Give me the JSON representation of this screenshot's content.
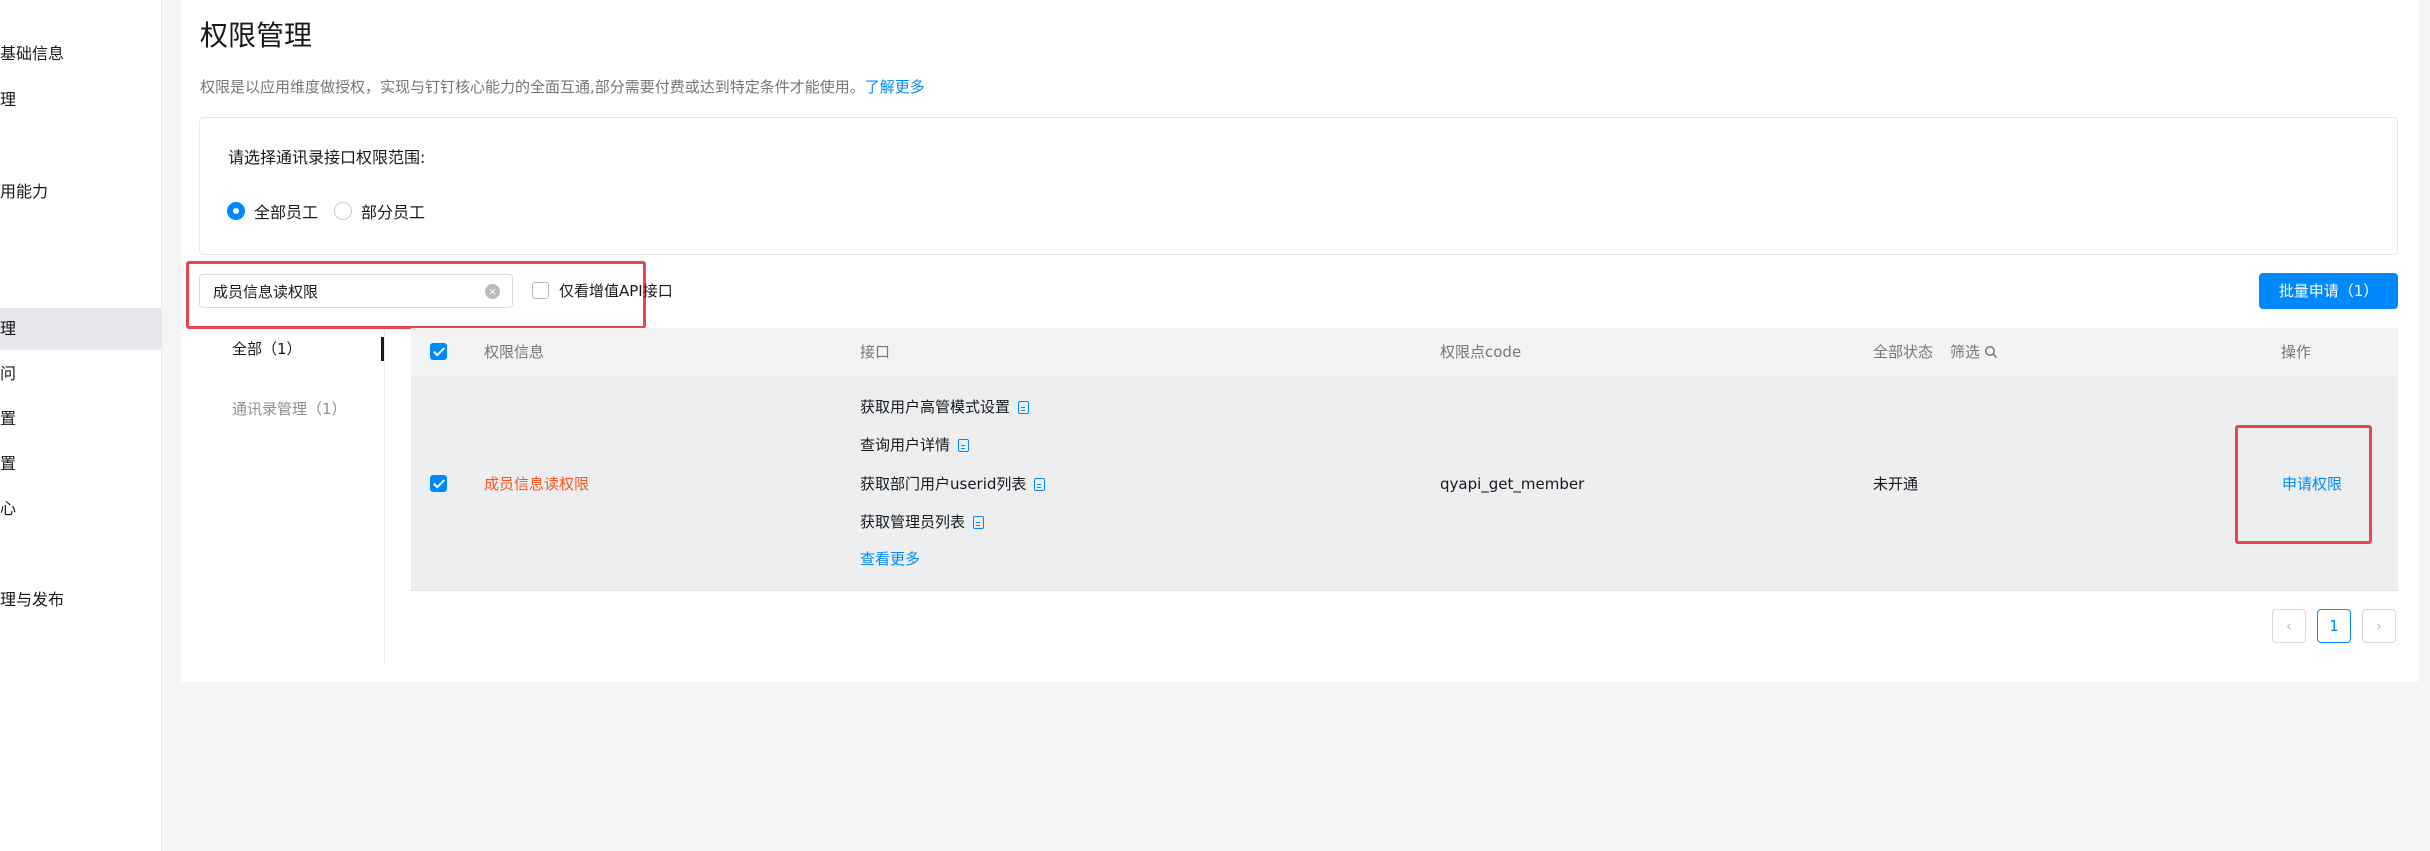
{
  "sidebar": {
    "items": [
      {
        "label": "基础信息"
      },
      {
        "label": "理"
      },
      {
        "label": "用能力"
      },
      {
        "label": "理"
      },
      {
        "label": "问"
      },
      {
        "label": "置"
      },
      {
        "label": "置"
      },
      {
        "label": "心"
      },
      {
        "label": "理与发布"
      }
    ]
  },
  "header": {
    "title": "权限管理",
    "description": "权限是以应用维度做授权，实现与钉钉核心能力的全面互通,部分需要付费或达到特定条件才能使用。",
    "learn_more": "了解更多"
  },
  "scope": {
    "label": "请选择通讯录接口权限范围:",
    "options": [
      {
        "label": "全部员工",
        "checked": true
      },
      {
        "label": "部分员工",
        "checked": false
      }
    ]
  },
  "search": {
    "value": "成员信息读权限",
    "clear_icon": "close-circle-icon"
  },
  "filter": {
    "only_paid_label": "仅看增值API接口"
  },
  "batch_button": "批量申请（1）",
  "categories": [
    {
      "label": "全部（1）",
      "active": true
    },
    {
      "label": "通讯录管理（1）",
      "active": false
    }
  ],
  "table": {
    "headers": {
      "permission_info": "权限信息",
      "api": "接口",
      "code": "权限点code",
      "status": "全部状态",
      "filter": "筛选",
      "action": "操作"
    },
    "rows": [
      {
        "name": "成员信息读权限",
        "apis": [
          "获取用户高管模式设置",
          "查询用户详情",
          "获取部门用户userid列表",
          "获取管理员列表"
        ],
        "more": "查看更多",
        "code": "qyapi_get_member",
        "status": "未开通",
        "action": "申请权限"
      }
    ]
  },
  "pagination": {
    "current": "1"
  },
  "colors": {
    "primary": "#0089ff",
    "highlight_red": "#e8474d",
    "permission_name": "#ff5219"
  }
}
